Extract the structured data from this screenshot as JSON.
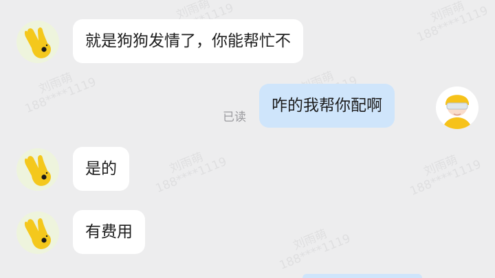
{
  "watermark": {
    "name": "刘雨萌",
    "phone": "188****1119"
  },
  "messages": [
    {
      "side": "left",
      "text": "就是狗狗发情了，你能帮忙不"
    },
    {
      "side": "right",
      "text": "咋的我帮你配啊",
      "status": "已读"
    },
    {
      "side": "left",
      "text": "是的"
    },
    {
      "side": "left",
      "text": "有费用"
    }
  ],
  "colors": {
    "background": "#ededee",
    "incoming_bubble": "#ffffff",
    "outgoing_bubble": "#cfe5fb",
    "read_status": "#9a9a9e"
  },
  "icons": {
    "contact_avatar": "yellow-victory-hand-icon",
    "my_avatar": "yellow-helmet-person-icon"
  }
}
